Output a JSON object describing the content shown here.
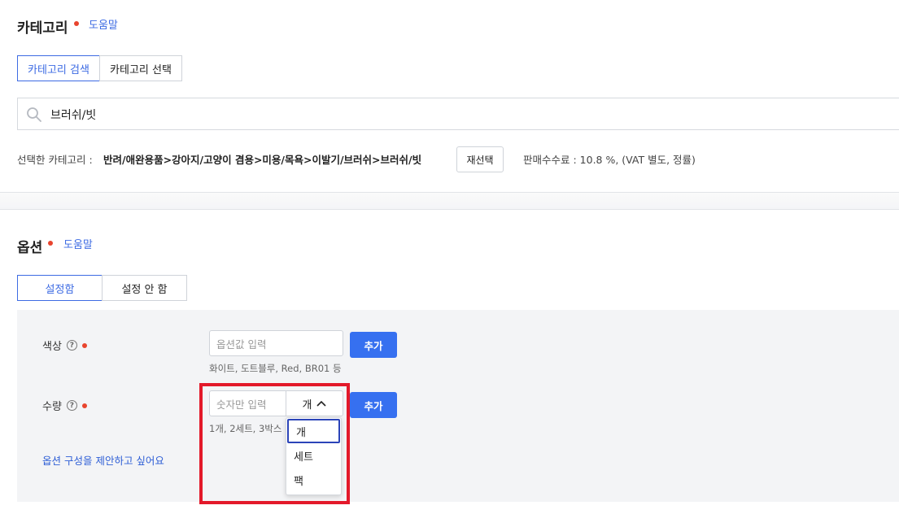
{
  "category": {
    "title": "카테고리",
    "help": "도움말",
    "tabs": [
      {
        "label": "카테고리 검색",
        "active": true
      },
      {
        "label": "카테고리 선택",
        "active": false
      }
    ],
    "search_value": "브러쉬/빗",
    "selected_label": "선택한 카테고리 :",
    "selected_path": "반려/애완용품>강아지/고양이 겸용>미용/목욕>이발기/브러쉬>브러쉬/빗",
    "reselect_label": "재선택",
    "fee_text": "판매수수료 : 10.8 %, (VAT 별도, 정률)"
  },
  "options": {
    "title": "옵션",
    "help": "도움말",
    "tabs": [
      {
        "label": "설정함",
        "active": true
      },
      {
        "label": "설정 안 함",
        "active": false
      }
    ],
    "color": {
      "label": "색상",
      "placeholder": "옵션값 입력",
      "add_label": "추가",
      "hint": "화이트, 도트블루, Red, BR01 등"
    },
    "quantity": {
      "label": "수량",
      "placeholder": "숫자만 입력",
      "unit_selected": "개",
      "add_label": "추가",
      "hint": "1개, 2세트, 3박스 등",
      "unit_options": [
        "개",
        "세트",
        "팩"
      ]
    },
    "suggest_link": "옵션 구성을 제안하고 싶어요"
  },
  "colors": {
    "accent": "#3d6be3",
    "primary_button": "#3670f0",
    "required_dot": "#e8442e",
    "highlight": "#e3192a"
  }
}
